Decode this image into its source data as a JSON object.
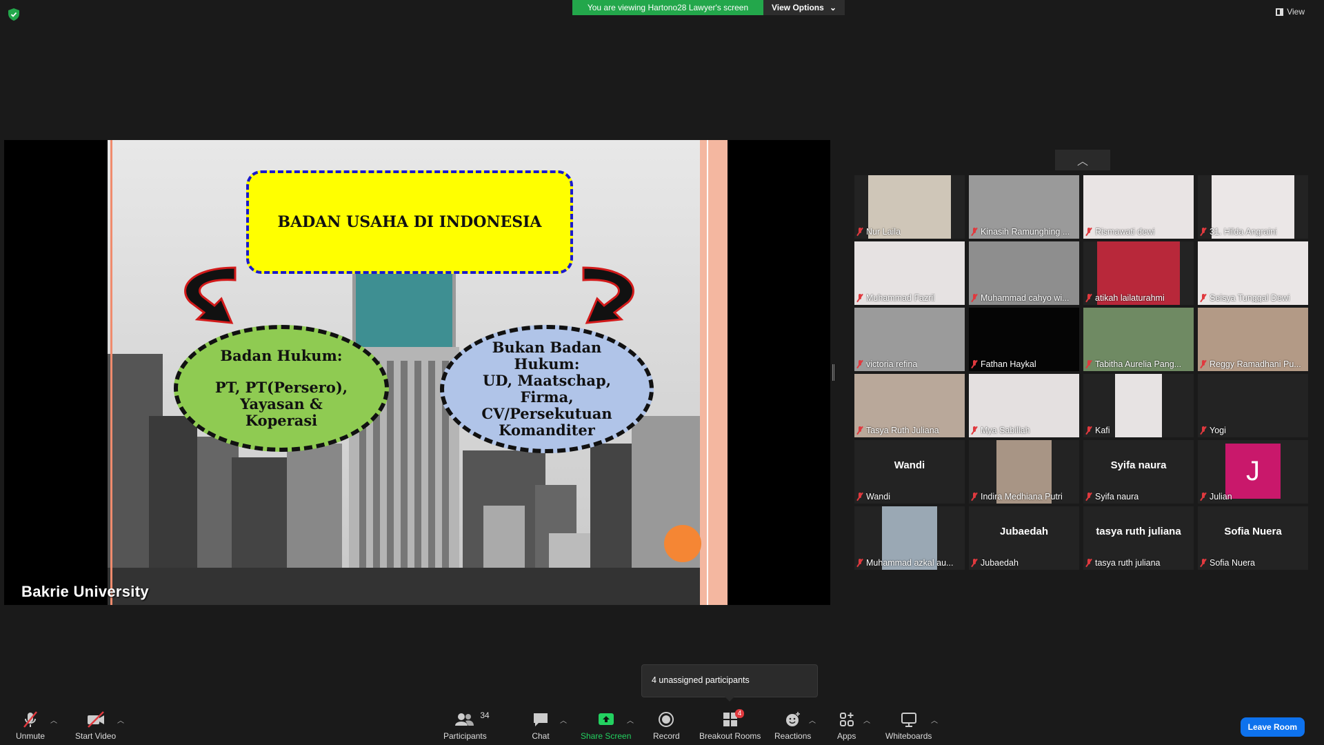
{
  "top": {
    "banner_text": "You are viewing Hartono28 Lawyer's screen",
    "view_options": "View Options",
    "view_label": "View"
  },
  "slide": {
    "title": "BADAN USAHA DI INDONESIA",
    "left_heading": "Badan Hukum:",
    "left_body_1": "PT, PT(Persero),",
    "left_body_2": "Yayasan &",
    "left_body_3": "Koperasi",
    "right_1": "Bukan Badan",
    "right_2": "Hukum:",
    "right_3": "UD, Maatschap,",
    "right_4": "Firma,",
    "right_5": "CV/Persekutuan",
    "right_6": "Komanditer",
    "university": "Bakrie  University"
  },
  "gallery": [
    {
      "name": "Nur Laila"
    },
    {
      "name": "Kinasih Ramunghing ..."
    },
    {
      "name": "Rismawati dewi"
    },
    {
      "name": "31. Hilda Angraini"
    },
    {
      "name": "Muhammad Fazril"
    },
    {
      "name": "Muhammad cahyo wi..."
    },
    {
      "name": "atikah lailaturahmi"
    },
    {
      "name": "Seisya Tunggal Dewi"
    },
    {
      "name": "victoria refina"
    },
    {
      "name": "Fathan Haykal"
    },
    {
      "name": "Tabitha Aurelia Pang..."
    },
    {
      "name": "Reggy Ramadhani Pu..."
    },
    {
      "name": "Tasya Ruth Juliana"
    },
    {
      "name": "Mya Sabillah"
    },
    {
      "name": "Kafi"
    },
    {
      "name": "Yogi"
    },
    {
      "name": "Wandi",
      "big": "Wandi"
    },
    {
      "name": "Indira Medhiana Putri"
    },
    {
      "name": "Syifa naura",
      "big": "Syifa naura"
    },
    {
      "name": "Julian",
      "avatar": "J"
    },
    {
      "name": "Muhammad azkal au..."
    },
    {
      "name": "Jubaedah",
      "big": "Jubaedah"
    },
    {
      "name": "tasya ruth juliana",
      "big": "tasya ruth juliana"
    },
    {
      "name": "Sofia Nuera",
      "big": "Sofia Nuera"
    }
  ],
  "tooltip": "4 unassigned participants",
  "toolbar": {
    "unmute": "Unmute",
    "start_video": "Start Video",
    "participants": "Participants",
    "participants_count": "34",
    "chat": "Chat",
    "share_screen": "Share Screen",
    "record": "Record",
    "breakout_rooms": "Breakout Rooms",
    "breakout_badge": "4",
    "reactions": "Reactions",
    "apps": "Apps",
    "whiteboards": "Whiteboards",
    "leave": "Leave Room"
  },
  "colors": {
    "banner_green": "#23a74b",
    "leave_blue": "#0e72ed",
    "muted_red": "#e0393e",
    "avatar_pink": "#c9186b"
  }
}
